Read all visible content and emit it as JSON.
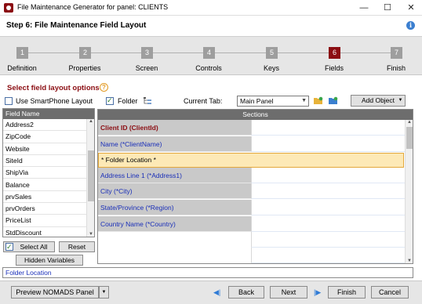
{
  "window": {
    "title": "File Maintenance Generator for panel: CLIENTS",
    "minimize": "—",
    "maximize": "☐",
    "close": "✕"
  },
  "header": {
    "step_title": "Step 6: File Maintenance Field Layout",
    "info_icon": "i"
  },
  "steps": [
    {
      "num": "1",
      "label": "Definition",
      "active": false
    },
    {
      "num": "2",
      "label": "Properties",
      "active": false
    },
    {
      "num": "3",
      "label": "Screen",
      "active": false
    },
    {
      "num": "4",
      "label": "Controls",
      "active": false
    },
    {
      "num": "5",
      "label": "Keys",
      "active": false
    },
    {
      "num": "6",
      "label": "Fields",
      "active": true
    },
    {
      "num": "7",
      "label": "Finish",
      "active": false
    }
  ],
  "options": {
    "title": "Select field layout options",
    "help_icon": "?",
    "use_smartphone_label": "Use SmartPhone Layout",
    "use_smartphone_checked": false,
    "folder_label": "Folder",
    "folder_checked": true,
    "current_tab_label": "Current Tab:",
    "current_tab_value": "Main Panel",
    "add_object_label": "Add Object"
  },
  "field_list": {
    "header": "Field Name",
    "items": [
      "Address2",
      "ZipCode",
      "Website",
      "SiteId",
      "ShipVia",
      "Balance",
      "prvSales",
      "prvOrders",
      "PriceList",
      "StdDiscount"
    ]
  },
  "sections": {
    "header": "Sections",
    "rows": [
      {
        "label": "Client ID (ClientId)",
        "kind": "key"
      },
      {
        "label": "Name (*ClientName)",
        "kind": "normal"
      },
      {
        "label": "* Folder Location *",
        "kind": "folder"
      },
      {
        "label": "Address Line 1 (*Address1)",
        "kind": "normal"
      },
      {
        "label": "City (*City)",
        "kind": "normal"
      },
      {
        "label": "State/Province (*Region)",
        "kind": "normal"
      },
      {
        "label": "Country Name (*Country)",
        "kind": "normal"
      }
    ]
  },
  "list_buttons": {
    "select_all": "Select All",
    "select_all_checked": true,
    "reset": "Reset",
    "hidden_variables": "Hidden Variables"
  },
  "status_text": "Folder Location",
  "footer": {
    "preview": "Preview NOMADS Panel",
    "back": "Back",
    "next": "Next",
    "finish": "Finish",
    "cancel": "Cancel"
  },
  "colors": {
    "accent": "#8b0d12",
    "link_blue": "#1a2fb8",
    "folder_highlight": "#fde9b6",
    "step_inactive": "#9e9e9e"
  }
}
